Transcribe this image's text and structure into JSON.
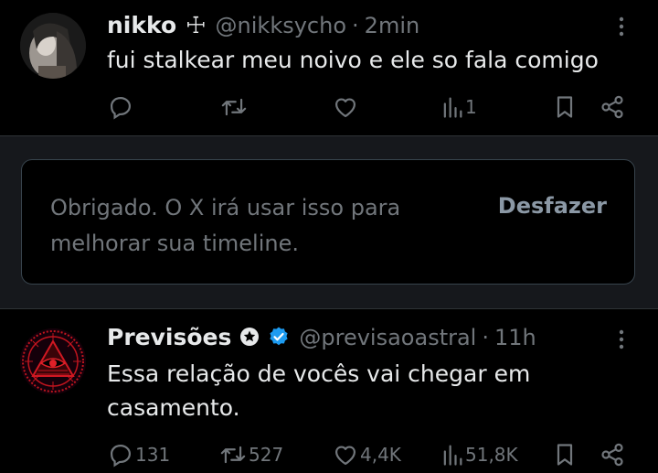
{
  "tweets": [
    {
      "name": "nikko",
      "name_suffix": "☩",
      "handle": "@nikksycho",
      "separator": "·",
      "time": "2min",
      "text": "fui stalkear meu noivo e ele so fala comigo",
      "stats": {
        "replies": "",
        "reposts": "",
        "likes": "",
        "views": "1"
      },
      "avatar_icon": "profile-photo"
    },
    {
      "name": "Previsões",
      "handle": "@previsaoastral",
      "separator": "·",
      "time": "11h",
      "text_line1": "Essa relação de vocês vai chegar em",
      "text_line2": "casamento.",
      "stats": {
        "replies": "131",
        "reposts": "527",
        "likes": "4,4K",
        "views": "51,8K"
      },
      "avatar_icon": "eye-of-providence-seal"
    }
  ],
  "notice": {
    "message": "Obrigado. O X irá usar isso para melhorar sua timeline.",
    "undo_label": "Desfazer"
  },
  "icons": [
    "reply-icon",
    "repost-icon",
    "like-icon",
    "views-icon",
    "bookmark-icon",
    "share-icon",
    "more-icon",
    "verified-badge-icon",
    "star-badge-icon"
  ],
  "colors": {
    "background": "#000000",
    "text": "#e7e9ea",
    "muted": "#71767b",
    "verified": "#1d9bf0",
    "avatar_seal": "#c0141e"
  }
}
